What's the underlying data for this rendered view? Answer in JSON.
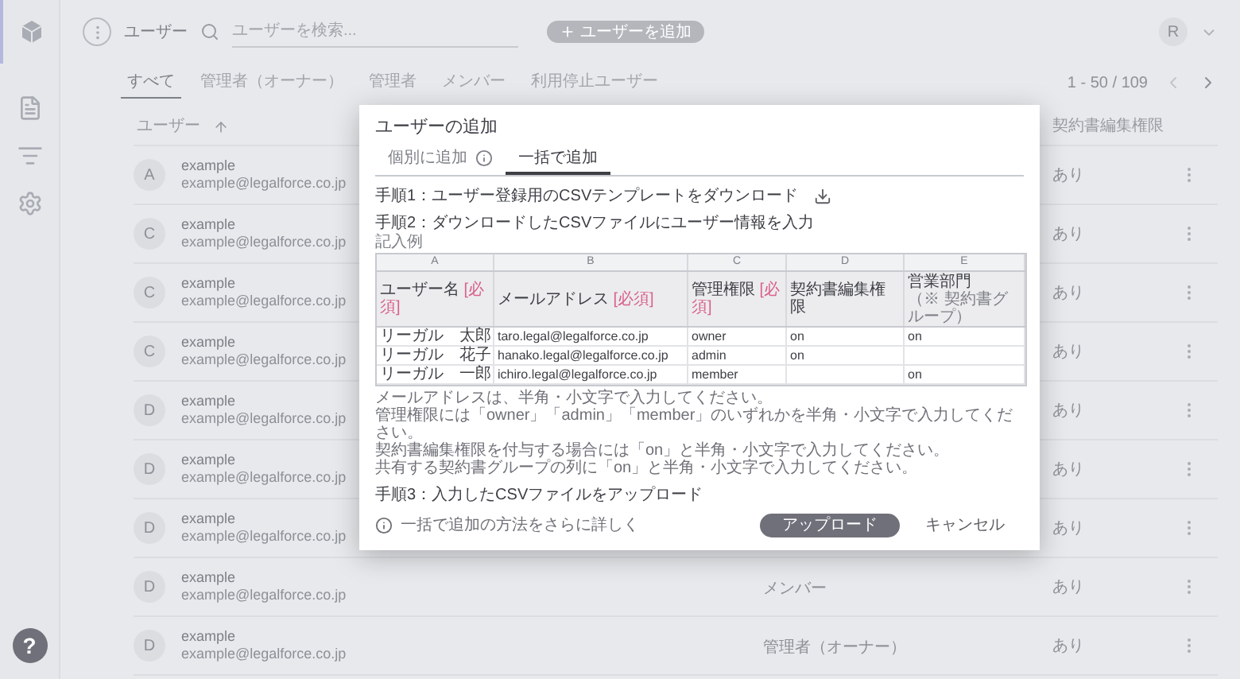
{
  "sidebar": {
    "items": [
      {
        "kind": "document",
        "selected": false
      },
      {
        "kind": "search-list",
        "selected": false
      },
      {
        "kind": "gears",
        "selected": false
      }
    ],
    "help_label": "?"
  },
  "topbar": {
    "title": "ユーザー",
    "search": {
      "placeholder": "ユーザーを検索..."
    },
    "add_button": "ユーザーを追加",
    "avatar": "R"
  },
  "filter_tabs": [
    {
      "label": "すべて",
      "selected": true
    },
    {
      "label": "管理者（オーナー）",
      "selected": false
    },
    {
      "label": "管理者",
      "selected": false
    },
    {
      "label": "メンバー",
      "selected": false
    },
    {
      "label": "利用停止ユーザー",
      "selected": false
    }
  ],
  "pagination": "1 - 50 / 109",
  "table": {
    "columns": [
      "ユーザー",
      "契約書編集権限"
    ],
    "rows": [
      {
        "avatar": "A",
        "name": "example",
        "email": "example@legalforce.co.jp",
        "edit": "あり"
      },
      {
        "avatar": "C",
        "name": "example",
        "email": "example@legalforce.co.jp",
        "edit": "あり"
      },
      {
        "avatar": "C",
        "name": "example",
        "email": "example@legalforce.co.jp",
        "edit": "あり"
      },
      {
        "avatar": "C",
        "name": "example",
        "email": "example@legalforce.co.jp",
        "edit": "あり"
      },
      {
        "avatar": "D",
        "name": "example",
        "email": "example@legalforce.co.jp",
        "edit": "あり"
      },
      {
        "avatar": "D",
        "name": "example",
        "email": "example@legalforce.co.jp",
        "edit": "あり"
      },
      {
        "avatar": "D",
        "name": "example",
        "email": "example@legalforce.co.jp",
        "edit": "あり"
      },
      {
        "avatar": "D",
        "name": "example",
        "email": "example@legalforce.co.jp",
        "role": "メンバー",
        "edit": "あり"
      },
      {
        "avatar": "D",
        "name": "example",
        "email": "example@legalforce.co.jp",
        "role": "管理者（オーナー）",
        "edit": "あり"
      }
    ]
  },
  "dialog": {
    "title": "ユーザーの追加",
    "tabs": [
      {
        "label": "個別に追加",
        "info": true,
        "selected": false
      },
      {
        "label": "一括で追加",
        "info": false,
        "selected": true
      }
    ],
    "step1": "手順1：ユーザー登録用のCSVテンプレートをダウンロード",
    "step2": "手順2：ダウンロードしたCSVファイルにユーザー情報を入力",
    "example_label": "記入例",
    "sample_table": {
      "column_letters": [
        "A",
        "B",
        "C",
        "D",
        "E"
      ],
      "headers": [
        {
          "label": "ユーザー名",
          "required": "[必須]"
        },
        {
          "label": "メールアドレス",
          "required": "[必須]"
        },
        {
          "label": "管理権限",
          "required": "[必須]"
        },
        {
          "label": "契約書編集権限"
        },
        {
          "label": "営業部門",
          "note": "（※ 契約書グループ）"
        }
      ],
      "rows": [
        {
          "name": "リーガル　太郎",
          "email": "taro.legal@legalforce.co.jp",
          "role": "owner",
          "edit": "on",
          "group": "on"
        },
        {
          "name": "リーガル　花子",
          "email": "hanako.legal@legalforce.co.jp",
          "role": "admin",
          "edit": "on"
        },
        {
          "name": "リーガル　一郎",
          "email": "ichiro.legal@legalforce.co.jp",
          "role": "member",
          "group": "on"
        }
      ]
    },
    "notes": [
      "メールアドレスは、半角・小文字で入力してください。",
      "管理権限には「owner」「admin」「member」のいずれかを半角・小文字で入力してください。",
      "契約書編集権限を付与する場合には「on」と半角・小文字で入力してください。",
      "共有する契約書グループの列に「on」と半角・小文字で入力してください。"
    ],
    "step3": "手順3：入力したCSVファイルをアップロード",
    "help_link": "一括で追加の方法をさらに詳しく",
    "upload_button": "アップロード",
    "cancel_button": "キャンセル"
  }
}
